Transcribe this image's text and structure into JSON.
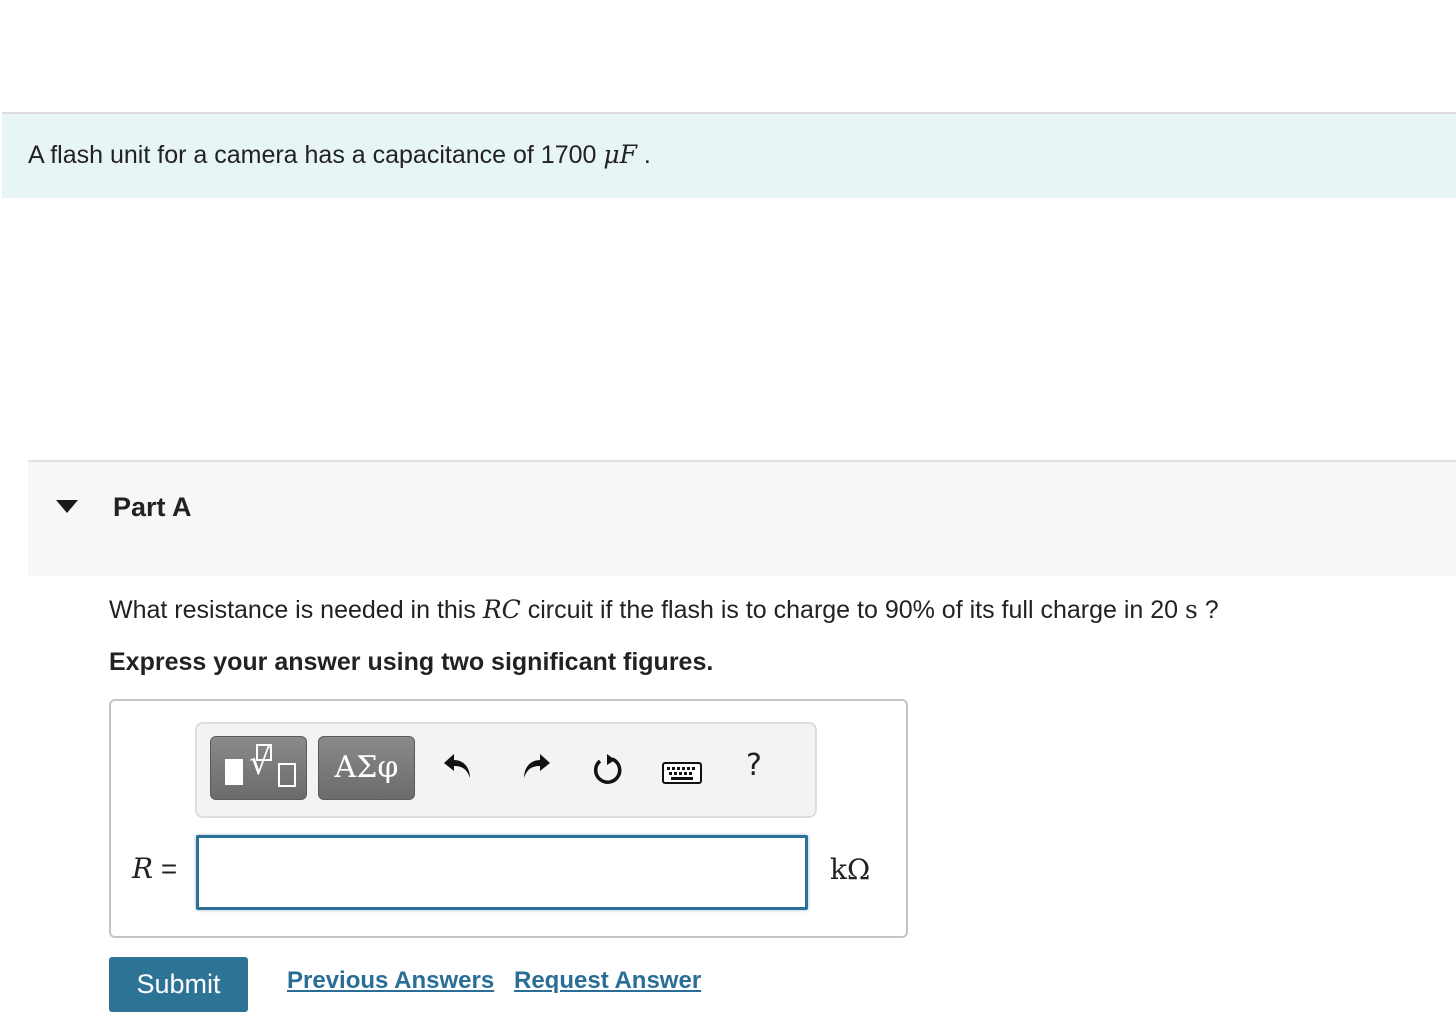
{
  "intro": {
    "text_before": "A flash unit for a camera has a capacitance of 1700 ",
    "unit": "μF",
    "text_after": " ."
  },
  "part": {
    "title": "Part A",
    "question_before": "What resistance is needed in this ",
    "question_math": "RC",
    "question_after": " circuit if the flash is to charge to 90% of its full charge in 20 ",
    "question_unit": "s",
    "question_end": " ?",
    "instruction": "Express your answer using two significant figures."
  },
  "toolbar": {
    "symbols_label": "ΑΣφ",
    "help_label": "?",
    "icons": [
      "templates-icon",
      "undo-icon",
      "redo-icon",
      "reset-icon",
      "keyboard-icon",
      "help-icon"
    ]
  },
  "answer": {
    "variable": "R",
    "equals": " =",
    "value": "",
    "unit": "kΩ"
  },
  "actions": {
    "submit_label": "Submit",
    "previous_answers_label": "Previous Answers",
    "request_answer_label": "Request Answer"
  },
  "colors": {
    "intro_bg": "#e8f5f5",
    "part_bg": "#f7f7f7",
    "submit_bg": "#2d7396",
    "link": "#2a6e98",
    "input_border": "#2c6f98"
  }
}
